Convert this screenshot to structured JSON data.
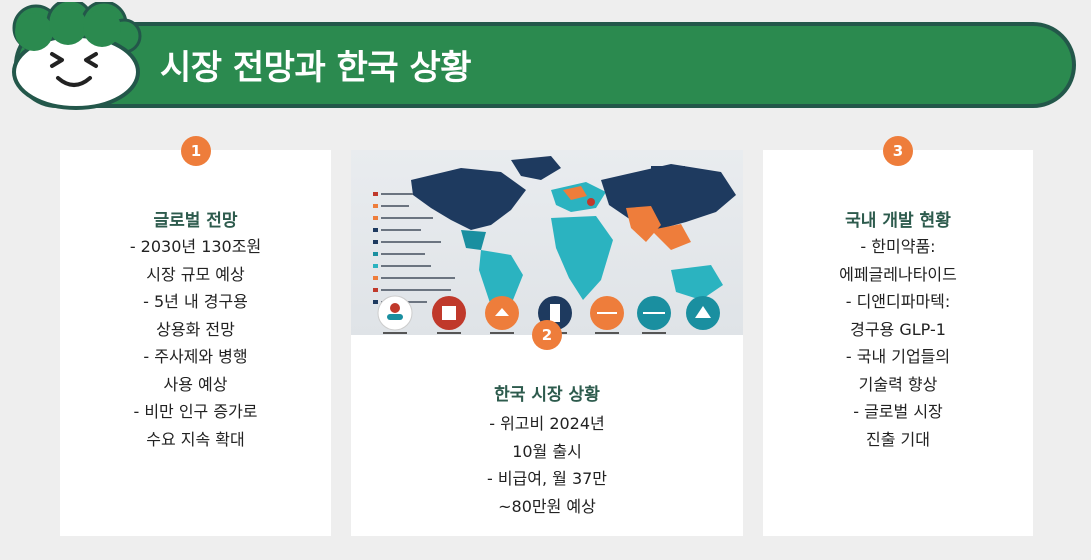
{
  "title": "시장 전망과 한국 상황",
  "colors": {
    "banner": "#2b8a4f",
    "banner_border": "#23574a",
    "badge": "#ee7d3b",
    "card_title": "#2d5b4d",
    "background": "#eeeeee"
  },
  "mascot": {
    "icon": "smiling-face-icon"
  },
  "cards": [
    {
      "badge": "1",
      "title": "글로벌 전망",
      "lines": [
        "- 2030년 130조원",
        "시장 규모 예상",
        "- 5년 내 경구용",
        "상용화 전망",
        "- 주사제와 병행",
        "사용 예상",
        "- 비만 인구 증가로",
        "수요 지속 확대"
      ]
    },
    {
      "badge": "2",
      "title": "한국 시장 상황",
      "image": {
        "icon": "world-map-infographic-icon"
      },
      "lines": [
        "- 위고비 2024년",
        "10월 출시",
        "- 비급여, 월 37만",
        "~80만원 예상"
      ]
    },
    {
      "badge": "3",
      "title": "국내 개발 현황",
      "lines": [
        "- 한미약품:",
        "에페글레나타이드",
        "- 디앤디파마텍:",
        "경구용 GLP-1",
        "- 국내 기업들의",
        "기술력 향상",
        "- 글로벌 시장",
        "진출 기대"
      ]
    }
  ]
}
